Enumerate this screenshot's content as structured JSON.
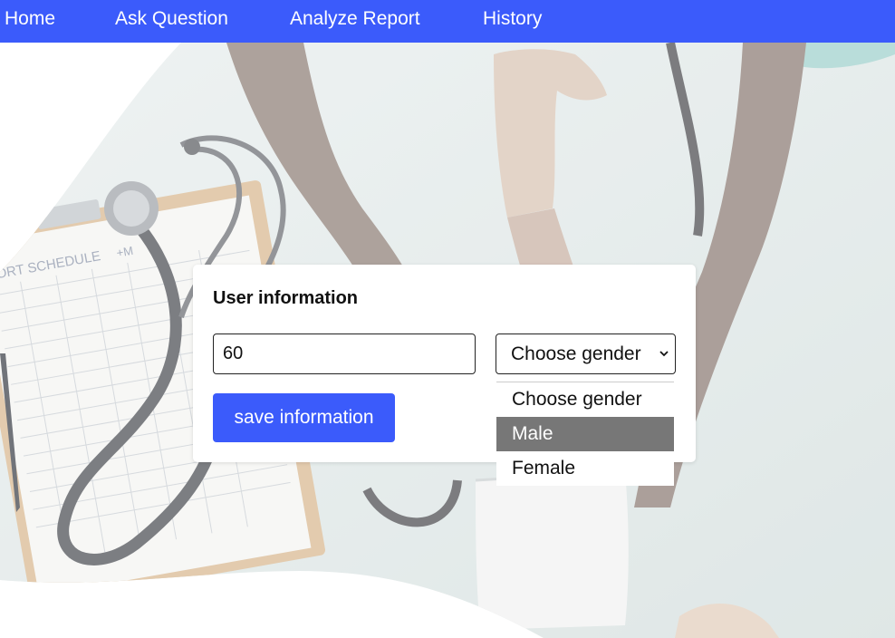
{
  "nav": {
    "items": [
      {
        "label": "Home"
      },
      {
        "label": "Ask Question"
      },
      {
        "label": "Analyze Report"
      },
      {
        "label": "History"
      }
    ]
  },
  "hero": {
    "clipboard_text": "PORT SCHEDULE",
    "clipboard_text_2": "+M"
  },
  "form": {
    "title": "User information",
    "age_value": "60",
    "gender_selected": "Choose gender",
    "gender_options": [
      "Choose gender",
      "Male",
      "Female"
    ],
    "gender_highlighted": "Male",
    "save_label": "save information"
  },
  "colors": {
    "accent": "#3b5bfb",
    "highlight": "#777777"
  }
}
